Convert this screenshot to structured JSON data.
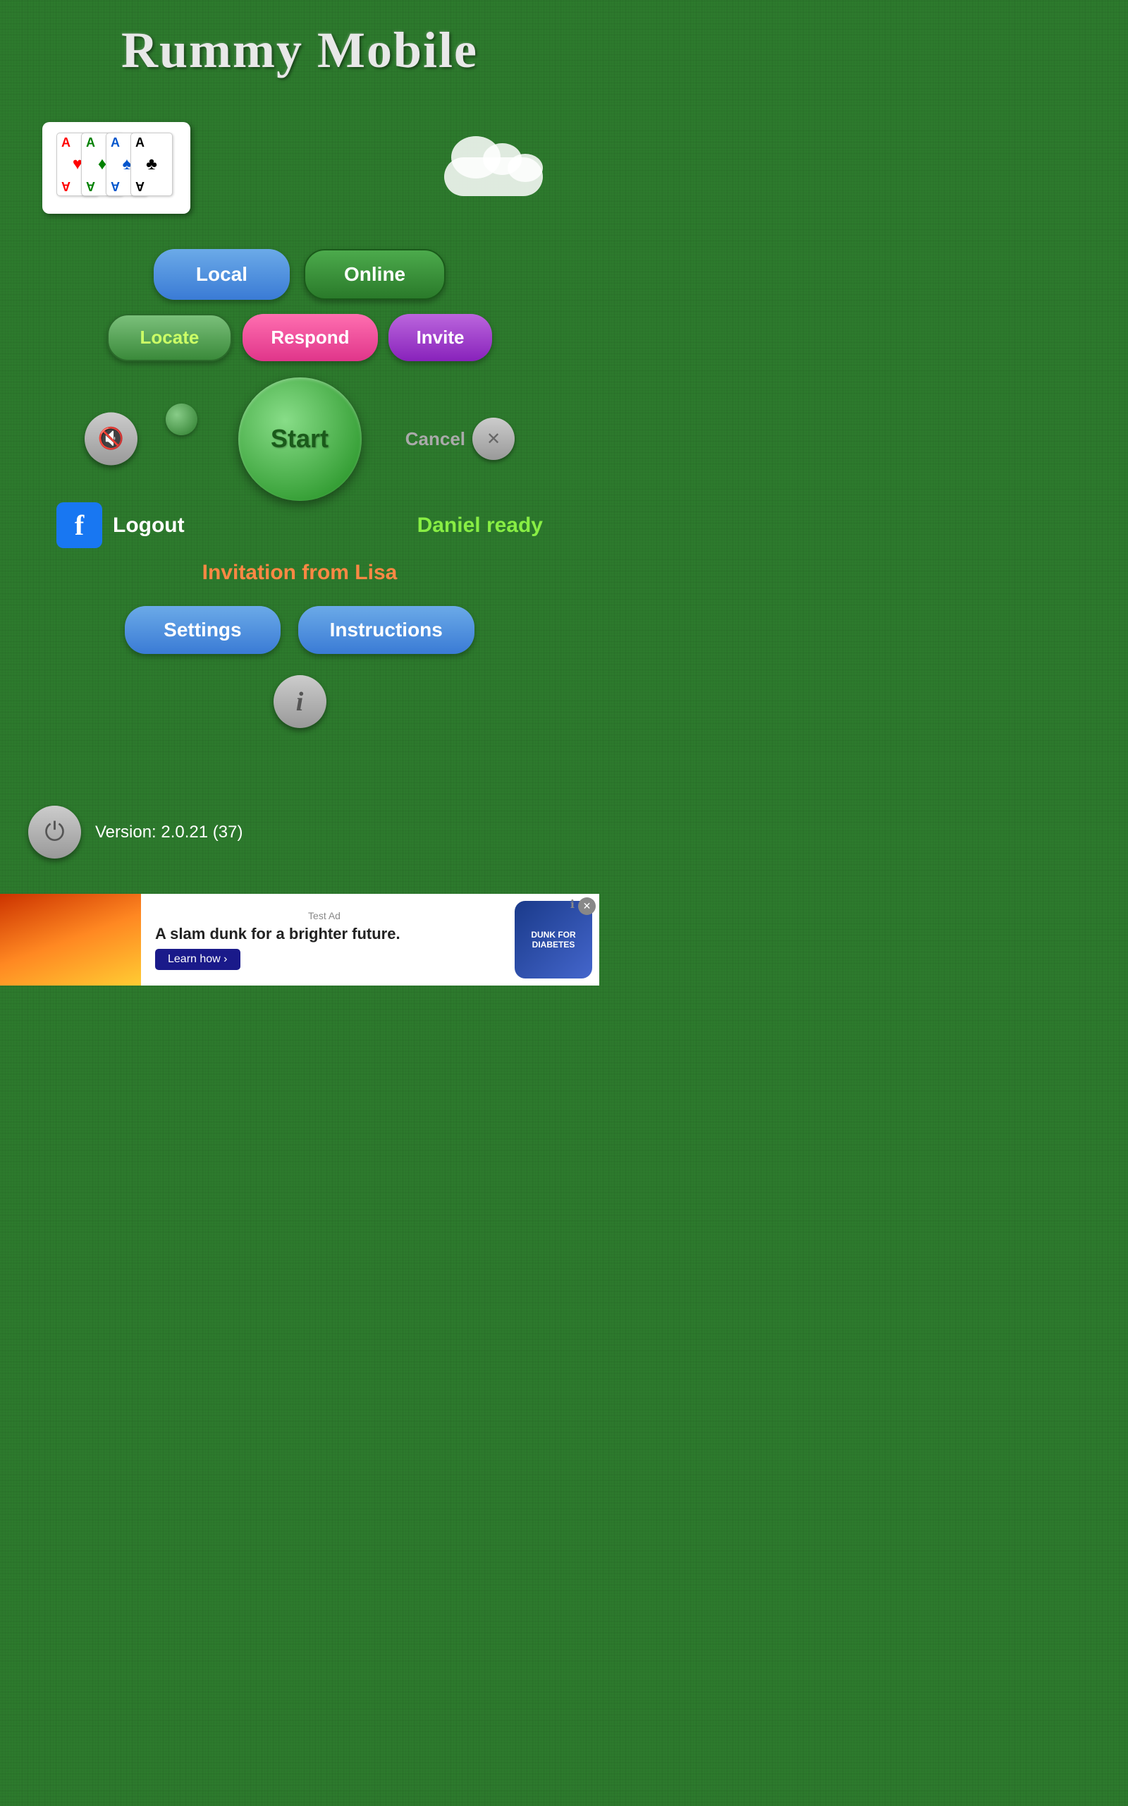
{
  "app": {
    "title": "Rummy Mobile"
  },
  "buttons": {
    "local": "Local",
    "online": "Online",
    "locate": "Locate",
    "respond": "Respond",
    "invite": "Invite",
    "start": "Start",
    "cancel": "Cancel",
    "logout": "Logout",
    "settings": "Settings",
    "instructions": "Instructions"
  },
  "status": {
    "player_ready": "Daniel ready",
    "invitation": "Invitation from Lisa"
  },
  "version": {
    "text": "Version: 2.0.21 (37)"
  },
  "ad": {
    "test_label": "Test Ad",
    "main_text": "A slam dunk for a brighter future.",
    "learn_more": "Learn how ›",
    "logo_text": "DUNK FOR DIABETES"
  },
  "cards": [
    {
      "letter": "A",
      "suit": "♥",
      "color": "red"
    },
    {
      "letter": "A",
      "suit": "♦",
      "color": "green"
    },
    {
      "letter": "A",
      "suit": "♠",
      "color": "blue"
    },
    {
      "letter": "A",
      "suit": "♣",
      "color": "black"
    }
  ]
}
